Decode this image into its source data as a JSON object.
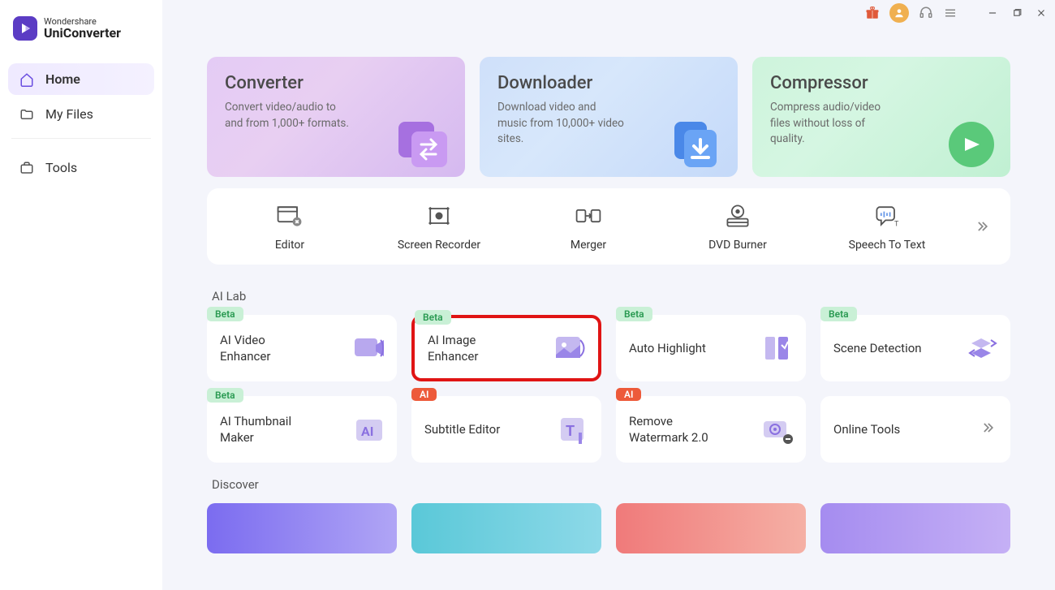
{
  "brand": {
    "top": "Wondershare",
    "bottom": "UniConverter"
  },
  "sidebar": {
    "items": [
      {
        "label": "Home",
        "icon": "home-icon",
        "active": true
      },
      {
        "label": "My Files",
        "icon": "folder-icon",
        "active": false
      }
    ],
    "bottom": [
      {
        "label": "Tools",
        "icon": "briefcase-icon"
      }
    ]
  },
  "hero": [
    {
      "title": "Converter",
      "desc": "Convert video/audio to and from 1,000+ formats."
    },
    {
      "title": "Downloader",
      "desc": "Download video and music from 10,000+ video sites."
    },
    {
      "title": "Compressor",
      "desc": "Compress audio/video files without loss of quality."
    }
  ],
  "tool_strip": [
    {
      "label": "Editor"
    },
    {
      "label": "Screen Recorder"
    },
    {
      "label": "Merger"
    },
    {
      "label": "DVD Burner"
    },
    {
      "label": "Speech To Text"
    }
  ],
  "sections": {
    "ai_lab_title": "AI Lab",
    "discover_title": "Discover"
  },
  "ai_lab": [
    {
      "badge": "Beta",
      "badge_type": "beta",
      "label": "AI Video Enhancer",
      "highlighted": false
    },
    {
      "badge": "Beta",
      "badge_type": "beta",
      "label": "AI Image Enhancer",
      "highlighted": true
    },
    {
      "badge": "Beta",
      "badge_type": "beta",
      "label": "Auto Highlight",
      "highlighted": false
    },
    {
      "badge": "Beta",
      "badge_type": "beta",
      "label": "Scene Detection",
      "highlighted": false
    },
    {
      "badge": "Beta",
      "badge_type": "beta",
      "label": "AI Thumbnail Maker",
      "highlighted": false
    },
    {
      "badge": "AI",
      "badge_type": "ai",
      "label": "Subtitle Editor",
      "highlighted": false
    },
    {
      "badge": "AI",
      "badge_type": "ai",
      "label": "Remove Watermark 2.0",
      "highlighted": false
    },
    {
      "badge": "",
      "badge_type": "",
      "label": "Online Tools",
      "highlighted": false,
      "arrow": true
    }
  ]
}
